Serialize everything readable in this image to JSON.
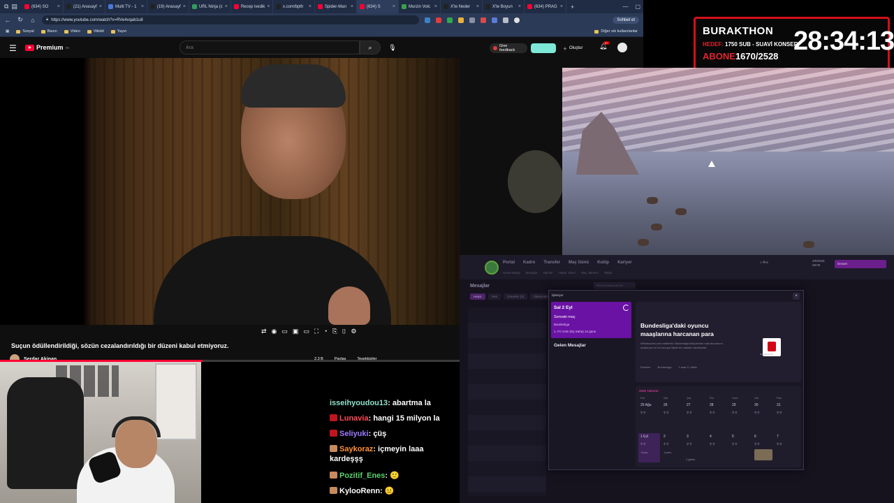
{
  "browser": {
    "tabs": [
      {
        "label": "(634) SO",
        "color": "#ff0033"
      },
      {
        "label": "(21) Anasayf",
        "color": "#222222"
      },
      {
        "label": "Multi TV - 1",
        "color": "#4a78d6"
      },
      {
        "label": "(19) Anasayf",
        "color": "#222222"
      },
      {
        "label": "URL Ninja (c",
        "color": "#2f9e5a"
      },
      {
        "label": "Recep ivedik",
        "color": "#ff0033"
      },
      {
        "label": "x.com/bpth",
        "color": "#222222"
      },
      {
        "label": "Spider-Man",
        "color": "#ff0033"
      },
      {
        "label": "(634) S",
        "color": "#ff0033"
      },
      {
        "label": "Murzin Volc",
        "color": "#3aa04a"
      },
      {
        "label": "X'te Neder",
        "color": "#222222"
      },
      {
        "label": "X'te Boyun",
        "color": "#222222"
      },
      {
        "label": "(634) PRAG",
        "color": "#ff0033"
      }
    ],
    "url": "https://www.youtube.com/watch?v=RVe4vqab1u8",
    "chat_button": "Sohbet et",
    "bookmarks": [
      "Sosyal",
      "Basın",
      "Video",
      "Vikidd",
      "Yayın"
    ],
    "bookmarks_other": "Diğer sık kullanılanlar"
  },
  "youtube": {
    "logo": "Premium",
    "logo_sup": "TR",
    "search_placeholder": "Ara",
    "feedback": "Give feedback",
    "create": "Oluştur",
    "bell_badge": "9+",
    "caption": "Suçun ödüllendirildiği, sözün cezalandırıldığı bir düzeni kabul etmiyoruz.",
    "channel": "Serdar Akinan",
    "actions": [
      "2,3 B",
      "Paylaş",
      "Teşekkürler"
    ],
    "progress": 0.44
  },
  "overlay": {
    "name": "BURAKTHON",
    "hedef_label": "HEDEF:",
    "hedef_value": "1750 SUB - SUAVİ KONSER",
    "abone_label": "ABONE",
    "abone_value": "1670/2528",
    "clock": "28:34:13"
  },
  "chat": [
    {
      "user": "isseihyoudou13",
      "text": "abartma la",
      "color": "#8fe0c8",
      "badge": ""
    },
    {
      "user": "Lunavia",
      "text": "hangi 15 milyon la",
      "color": "#ff4a57",
      "badge": "#c0141f"
    },
    {
      "user": "Seliyuki",
      "text": "çüş",
      "color": "#9b7cff",
      "badge": "#c0141f"
    },
    {
      "user": "Saykoraz",
      "text": "içmeyin laaa kardeşşş",
      "color": "#ff8f3a",
      "badge": "#c68a5d"
    },
    {
      "user": "Pozitif_Enes",
      "text": "🙂",
      "color": "#5ad16b",
      "badge": "#c68a5d"
    },
    {
      "user": "KylooRenn",
      "text": "😐",
      "color": "#ffffff",
      "badge": "#c68a5d"
    }
  ],
  "fm": {
    "nav": [
      "Portal",
      "Kadro",
      "Transfer",
      "Maç Günü",
      "Kulüp",
      "Kariyer"
    ],
    "subnav": [
      "Genel Bakış",
      "Mesajlar",
      "Takvim",
      "Haber Sitesi",
      "Maç Takvimi",
      "Taktik"
    ],
    "search": "Ara",
    "date": "2/9/2025",
    "time": "08:00",
    "continue": "Devam",
    "messages_title": "Mesajlar",
    "messages_search": "Mesaj Kutusunda Ara",
    "tabs": [
      "Hepsi",
      "Yeni",
      "Görevler (2)",
      "Okunmamış"
    ],
    "modal_title": "İşleniyor",
    "side_date": "Sal 2 Eyl",
    "side_sub": "Sonraki maç",
    "side_league": "Bundesliga",
    "side_match": "1. FC Köln (Dş Saha) 12 güne",
    "side_inbox": "Gelen Mesajlar",
    "news_head": "Bundesliga'daki oyuncu maaşlarına harcanan para",
    "news_body": "Wholiscores.com editörleri, Bundesliga kulüplerinin mali durumunu araştırıyor ve bu konuya ilişkin bir makale hazırladılar.",
    "news_tags": [
      "Erkekler",
      "Bundesliga",
      "2 saat 1'i dakik"
    ],
    "logo_text": "BUNDESLIGA",
    "calendar_title": "2025 Takvimi",
    "calendar_headers": [
      "Pzt",
      "Sal",
      "Çar",
      "Per",
      "Cum",
      "Cts",
      "Paz"
    ],
    "week1": [
      "25 Ağu",
      "26",
      "27",
      "28",
      "29",
      "30",
      "31"
    ],
    "week2": [
      "1 Eyl",
      "2",
      "3",
      "4",
      "5",
      "6",
      "7"
    ],
    "cal_notes": [
      "Kons.",
      "1 prev.",
      "1 görev"
    ]
  }
}
